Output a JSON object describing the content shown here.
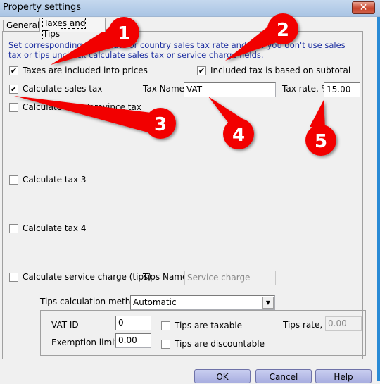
{
  "window": {
    "title": "Property settings",
    "close_icon": "close-icon"
  },
  "tabs": [
    {
      "label": "General",
      "active": false
    },
    {
      "label": "Taxes and Tips",
      "active": true
    }
  ],
  "info_text": "Set corresponding local state or country sales tax rate and ... If you don't use sales tax or tips uncheck calculate sales tax  or service charge fields.",
  "taxes_included": {
    "label": "Taxes are included into prices",
    "checked": true
  },
  "included_tax_subtotal": {
    "label": "Included tax is based on subtotal",
    "checked": true
  },
  "sales_tax": {
    "label": "Calculate sales tax",
    "checked": true,
    "tax_name_label": "Tax Name:",
    "tax_name_value": "VAT",
    "tax_rate_label": "Tax rate, %",
    "tax_rate_value": "15.00"
  },
  "state_tax": {
    "label": "Calculate state/province tax",
    "checked": false
  },
  "tax3": {
    "label": "Calculate tax 3",
    "checked": false
  },
  "tax4": {
    "label": "Calculate tax 4",
    "checked": false
  },
  "service_charge": {
    "label": "Calculate service charge (tips)",
    "checked": false,
    "tips_name_label": "Tips Name:",
    "tips_name_value": "Service charge"
  },
  "tips_method": {
    "label": "Tips calculation method",
    "value": "Automatic"
  },
  "tips_group": {
    "vat_id_label": "VAT ID",
    "vat_id_value": "0",
    "exemption_label": "Exemption limit",
    "exemption_value": "0.00",
    "taxable": {
      "label": "Tips are taxable",
      "checked": false
    },
    "discountable": {
      "label": "Tips are discountable",
      "checked": false
    },
    "tips_rate_label": "Tips rate, %",
    "tips_rate_value": "0.00"
  },
  "buttons": {
    "ok": "OK",
    "cancel": "Cancel",
    "help": "Help"
  },
  "callouts": [
    "1",
    "2",
    "3",
    "4",
    "5"
  ],
  "check_glyph": "✔",
  "dropdown_glyph": "▼"
}
